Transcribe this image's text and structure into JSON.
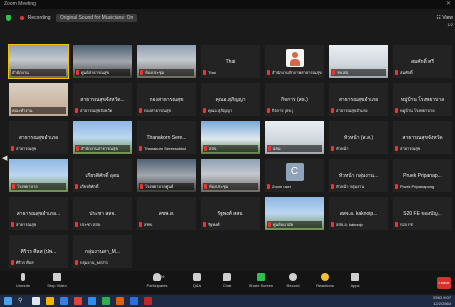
{
  "window": {
    "title": "Zoom Meeting",
    "close_glyph": "✕"
  },
  "infobar": {
    "recording_label": "Recording",
    "meeting_id": "Original Sound for Musicians: On",
    "view_label": "☷ View"
  },
  "page_indicator": "1/2",
  "tiles": [
    {
      "type": "video",
      "bg": "vid-room",
      "label": "สำนักงาน",
      "muted": false,
      "active": true
    },
    {
      "type": "video",
      "bg": "vid-room2",
      "label": "ศูนย์สาธารณสุข",
      "muted": true
    },
    {
      "type": "video",
      "bg": "vid-room",
      "label": "ห้องประชุม",
      "muted": true
    },
    {
      "type": "name",
      "name": "Thai",
      "label": "Thai",
      "muted": true
    },
    {
      "type": "avatar",
      "label": "สำนักงานกักภาพสาธารณสุข",
      "muted": true
    },
    {
      "type": "video",
      "bg": "vid-white",
      "label": "รพ.สต.",
      "muted": true
    },
    {
      "type": "name",
      "name": "สมศักดิ์ ศรี",
      "label": "สมศักดิ์",
      "muted": true
    },
    {
      "type": "video",
      "bg": "vid-person",
      "label": "คณะทำงาน",
      "muted": false
    },
    {
      "type": "name",
      "name": "สาธารณสุขจังหวัด...",
      "label": "สาธารณสุขจังหวัด",
      "muted": true
    },
    {
      "type": "name",
      "name": "กองสาธารณสุข",
      "label": "กองสาธารณสุข",
      "muted": true
    },
    {
      "type": "name",
      "name": "คุณอ.สุภิญญา",
      "label": "คุณอ.สุภิญญา",
      "muted": true
    },
    {
      "type": "name",
      "name": "กิจการ (สธ.)",
      "label": "กิจการ (สธ.)",
      "muted": true
    },
    {
      "type": "name",
      "name": "สาธารณสุขอำเภอ",
      "label": "สาธารณสุขอำเภอ",
      "muted": true
    },
    {
      "type": "name",
      "name": "หมู่บ้าน โรงพยาบาล",
      "label": "หมู่บ้าน โรงพยาบาล",
      "muted": true
    },
    {
      "type": "name",
      "name": "สาธารณสุขอำเภอ",
      "label": "สาธารณสุข",
      "muted": true
    },
    {
      "type": "video",
      "bg": "vid-sky",
      "label": "สำนักงานสาธารณสุข",
      "muted": true
    },
    {
      "type": "name",
      "name": "Thanakorn Sere...",
      "label": "Thanakorn Sereesukkul",
      "muted": true
    },
    {
      "type": "video",
      "bg": "vid-bus",
      "label": "สสจ.",
      "muted": true
    },
    {
      "type": "video",
      "bg": "vid-white",
      "label": "อสม.",
      "muted": true
    },
    {
      "type": "name",
      "name": "หัวหน้า (ส.ส.)",
      "label": "หัวหน้า",
      "muted": true
    },
    {
      "type": "name",
      "name": "สาธารณสุขจังหวัด",
      "label": "สาธารณสุข",
      "muted": true
    },
    {
      "type": "video",
      "bg": "vid-sky",
      "label": "โรงพยาบาล",
      "muted": true
    },
    {
      "type": "name",
      "name": "เกียรติศักดิ์ อุดม",
      "label": "เกียรติศักดิ์",
      "muted": true
    },
    {
      "type": "video",
      "bg": "vid-room2",
      "label": "โรงพยาบาลศูนย์",
      "muted": true
    },
    {
      "type": "video",
      "bg": "vid-room",
      "label": "ห้องประชุม",
      "muted": true
    },
    {
      "type": "letter",
      "letter": "C",
      "label": "Zoom user",
      "muted": true
    },
    {
      "type": "name",
      "name": "หัวหน้า กลุ่มงาน...",
      "label": "หัวหน้า กลุ่มงาน",
      "muted": true
    },
    {
      "type": "name",
      "name": "Pruek Pripanap...",
      "label": "Pruek Pripanapong",
      "muted": true
    },
    {
      "type": "name",
      "name": "สาธารณสุขอำเภอ...",
      "label": "สาธารณสุข",
      "muted": true
    },
    {
      "type": "name",
      "name": "ประชา สสจ.",
      "label": "ประชา สสจ.",
      "muted": true
    },
    {
      "type": "name",
      "name": "สชพ.ส.",
      "label": "สชพ.",
      "muted": true
    },
    {
      "type": "name",
      "name": "รัฐพงศ์ สสจ.",
      "label": "รัฐพงศ์",
      "muted": true
    },
    {
      "type": "video",
      "bg": "vid-sky",
      "label": "ศูนย์อนามัย",
      "muted": true
    },
    {
      "type": "name",
      "name": "สสจ.อ. kaknoip...",
      "label": "สสจ.อ. kaknoip",
      "muted": true
    },
    {
      "type": "name",
      "name": "S20 FE ของบัญ...",
      "label": "S20 FE",
      "muted": true
    },
    {
      "type": "name",
      "name": "ศิริวร ศีลส (ปพ...",
      "label": "ศิริวร ศีลส",
      "muted": true
    },
    {
      "type": "name",
      "name": "กลุ่มงานสา_M...",
      "label": "กลุ่มงาน_MSTS",
      "muted": true
    }
  ],
  "toolbar": {
    "unmute": "Unmute",
    "stop_video": "Stop Video",
    "participants": "Participants",
    "participant_count": "39",
    "qa": "Q&A",
    "chat": "Chat",
    "share_screen": "Share Screen",
    "record": "Record",
    "reactions": "Reactions",
    "apps": "Apps",
    "leave": "Leave"
  },
  "taskbar": {
    "time": "9:07",
    "date": "12/2/2564",
    "lang": "ENG"
  },
  "colors": {
    "active_border": "#f2c200",
    "share_green": "#2fbe4f",
    "leave_red": "#d9302a",
    "muted_red": "#e33333"
  }
}
